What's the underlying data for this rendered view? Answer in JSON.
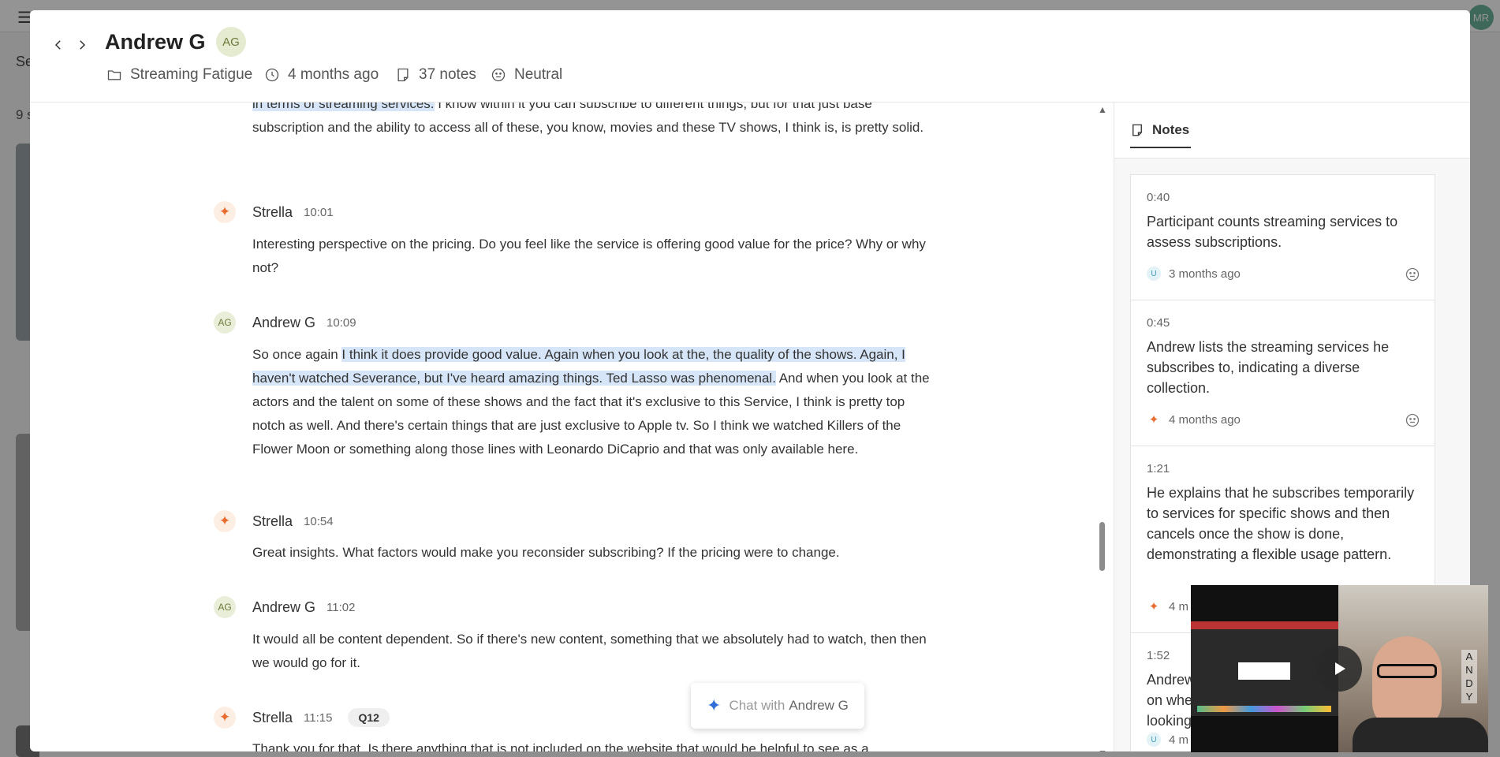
{
  "background": {
    "avatar_initials": "MR",
    "tab_label": "Se",
    "count_label": "9 s"
  },
  "header": {
    "title": "Andrew G",
    "avatar_initials": "AG",
    "project": "Streaming Fatigue",
    "time_ago": "4 months ago",
    "notes_count": "37 notes",
    "sentiment": "Neutral"
  },
  "transcript": {
    "blocks": [
      {
        "highlighted": "in terms of streaming services.",
        "text": " I know within it you can subscribe to different things, but for that just base subscription and the ability to access all of these, you know, movies and these TV shows, I think is, is pretty solid."
      },
      {
        "speaker": "Strella",
        "time": "10:01",
        "text": "Interesting perspective on the pricing. Do you feel like the service is offering good value for the price? Why or why not?"
      },
      {
        "speaker": "Andrew G",
        "initials": "AG",
        "time": "10:09",
        "text_before": "So once again ",
        "highlighted": "I think it does provide good value. Again when you look at the, the quality of the shows. Again, I haven't watched Severance, but I've heard amazing things. Ted Lasso was phenomenal.",
        "text_after": " And when you look at the actors and the talent on some of these shows and the fact that it's exclusive to this Service, I think is pretty top notch as well. And there's certain things that are just exclusive to Apple tv. So I think we watched Killers of the Flower Moon or something along those lines with Leonardo DiCaprio and that was only available here."
      },
      {
        "speaker": "Strella",
        "time": "10:54",
        "text": "Great insights. What factors would make you reconsider subscribing? If the pricing were to change."
      },
      {
        "speaker": "Andrew G",
        "initials": "AG",
        "time": "11:02",
        "text": "It would all be content dependent. So if there's new content, something that we absolutely had to watch, then then we would go for it."
      },
      {
        "speaker": "Strella",
        "time": "11:15",
        "badge": "Q12",
        "text": "Thank you for that. Is there anything that is not included on the website that would be helpful to see as a"
      }
    ]
  },
  "chat": {
    "prefix": "Chat with",
    "name": "Andrew G"
  },
  "notes": {
    "tab_label": "Notes",
    "items": [
      {
        "time": "0:40",
        "text": "Participant counts streaming services to assess subscriptions.",
        "source": "U",
        "ago": "3 months ago"
      },
      {
        "time": "0:45",
        "text": "Andrew lists the streaming services he subscribes to, indicating a diverse collection.",
        "source": "ai",
        "ago": "4 months ago"
      },
      {
        "time": "1:21",
        "text": "He explains that he subscribes temporarily to services for specific shows and then cancels once the show is done, demonstrating a flexible usage pattern.",
        "source": "ai",
        "ago": "4 m"
      },
      {
        "time": "1:52",
        "text": "Andrew\non whe\nlooking",
        "source": "U",
        "ago": "4 m"
      }
    ]
  },
  "video": {
    "side_letters": "A N D Y"
  },
  "colors": {
    "highlight": "#d6e6f8",
    "ai_accent": "#e86b2f",
    "chat_accent": "#2f6fd6"
  }
}
